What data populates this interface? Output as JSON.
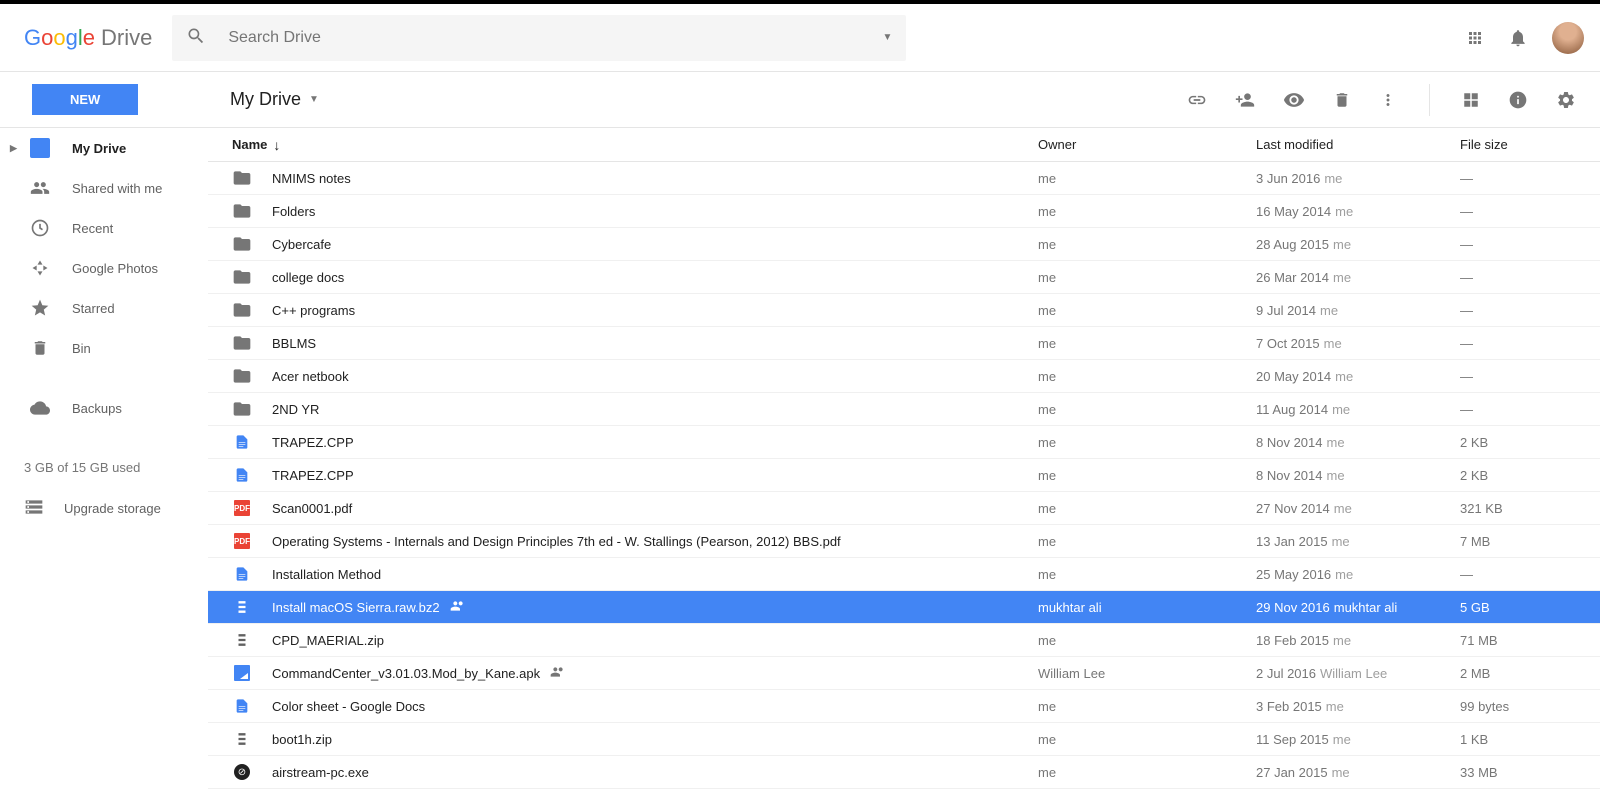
{
  "logo_text": "Drive",
  "search_placeholder": "Search Drive",
  "new_button": "NEW",
  "breadcrumb": "My Drive",
  "sidebar": {
    "items": [
      {
        "label": "My Drive",
        "icon": "drive"
      },
      {
        "label": "Shared with me",
        "icon": "people"
      },
      {
        "label": "Recent",
        "icon": "clock"
      },
      {
        "label": "Google Photos",
        "icon": "photos"
      },
      {
        "label": "Starred",
        "icon": "star"
      },
      {
        "label": "Bin",
        "icon": "trash"
      }
    ],
    "backups": "Backups",
    "storage_text": "3 GB of 15 GB used",
    "upgrade_text": "Upgrade storage"
  },
  "columns": {
    "name": "Name",
    "owner": "Owner",
    "modified": "Last modified",
    "size": "File size"
  },
  "files": [
    {
      "name": "NMIMS notes",
      "type": "folder",
      "owner": "me",
      "modified": "3 Jun 2016",
      "mod_by": "me",
      "size": "—"
    },
    {
      "name": "Folders",
      "type": "folder",
      "owner": "me",
      "modified": "16 May 2014",
      "mod_by": "me",
      "size": "—"
    },
    {
      "name": "Cybercafe",
      "type": "folder",
      "owner": "me",
      "modified": "28 Aug 2015",
      "mod_by": "me",
      "size": "—"
    },
    {
      "name": "college docs",
      "type": "folder",
      "owner": "me",
      "modified": "26 Mar 2014",
      "mod_by": "me",
      "size": "—"
    },
    {
      "name": "C++ programs",
      "type": "folder",
      "owner": "me",
      "modified": "9 Jul 2014",
      "mod_by": "me",
      "size": "—"
    },
    {
      "name": "BBLMS",
      "type": "folder",
      "owner": "me",
      "modified": "7 Oct 2015",
      "mod_by": "me",
      "size": "—"
    },
    {
      "name": "Acer netbook",
      "type": "folder",
      "owner": "me",
      "modified": "20 May 2014",
      "mod_by": "me",
      "size": "—"
    },
    {
      "name": "2ND YR",
      "type": "folder",
      "owner": "me",
      "modified": "11 Aug 2014",
      "mod_by": "me",
      "size": "—"
    },
    {
      "name": "TRAPEZ.CPP",
      "type": "docs",
      "owner": "me",
      "modified": "8 Nov 2014",
      "mod_by": "me",
      "size": "2 KB"
    },
    {
      "name": "TRAPEZ.CPP",
      "type": "docs",
      "owner": "me",
      "modified": "8 Nov 2014",
      "mod_by": "me",
      "size": "2 KB"
    },
    {
      "name": "Scan0001.pdf",
      "type": "pdf",
      "owner": "me",
      "modified": "27 Nov 2014",
      "mod_by": "me",
      "size": "321 KB"
    },
    {
      "name": "Operating Systems - Internals and Design Principles 7th ed - W. Stallings (Pearson, 2012) BBS.pdf",
      "type": "pdf",
      "owner": "me",
      "modified": "13 Jan 2015",
      "mod_by": "me",
      "size": "7 MB"
    },
    {
      "name": "Installation Method",
      "type": "docs",
      "owner": "me",
      "modified": "25 May 2016",
      "mod_by": "me",
      "size": "—"
    },
    {
      "name": "Install macOS Sierra.raw.bz2",
      "type": "zip",
      "owner": "mukhtar ali",
      "modified": "29 Nov 2016",
      "mod_by": "mukhtar ali",
      "size": "5 GB",
      "shared": true,
      "selected": true
    },
    {
      "name": "CPD_MAERIAL.zip",
      "type": "zip",
      "owner": "me",
      "modified": "18 Feb 2015",
      "mod_by": "me",
      "size": "71 MB"
    },
    {
      "name": "CommandCenter_v3.01.03.Mod_by_Kane.apk",
      "type": "image",
      "owner": "William Lee",
      "modified": "2 Jul 2016",
      "mod_by": "William Lee",
      "size": "2 MB",
      "shared": true
    },
    {
      "name": "Color sheet - Google Docs",
      "type": "docs",
      "owner": "me",
      "modified": "3 Feb 2015",
      "mod_by": "me",
      "size": "99 bytes"
    },
    {
      "name": "boot1h.zip",
      "type": "zip",
      "owner": "me",
      "modified": "11 Sep 2015",
      "mod_by": "me",
      "size": "1 KB"
    },
    {
      "name": "airstream-pc.exe",
      "type": "exe",
      "owner": "me",
      "modified": "27 Jan 2015",
      "mod_by": "me",
      "size": "33 MB"
    }
  ]
}
